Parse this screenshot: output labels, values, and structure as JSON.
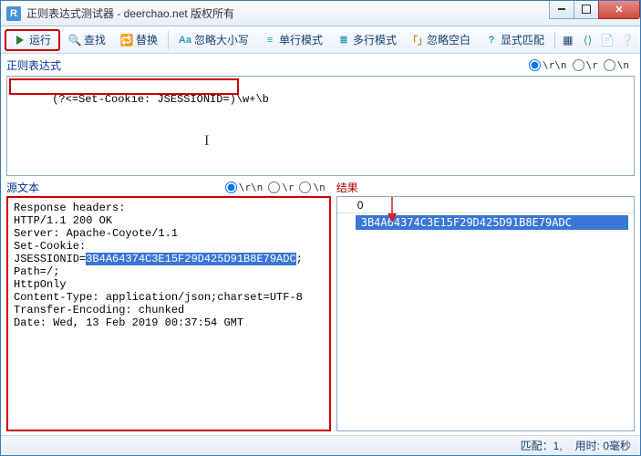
{
  "title": "正则表达式测试器 - deerchao.net 版权所有",
  "toolbar": {
    "run": "运行",
    "find": "查找",
    "replace": "替换",
    "ignorecase": "忽略大小写",
    "singleline": "单行模式",
    "multiline": "多行模式",
    "ignorews": "忽略空白",
    "explicit": "显式匹配"
  },
  "labels": {
    "regex": "正则表达式",
    "source": "源文本",
    "result": "结果"
  },
  "lineend": {
    "crlf": "\\r\\n",
    "cr": "\\r",
    "lf": "\\n"
  },
  "regex_input": "(?<=Set-Cookie: JSESSIONID=)\\w+\\b",
  "source_text": {
    "l1": "Response headers:",
    "l2": "HTTP/1.1 200 OK",
    "l3": "Server: Apache-Coyote/1.1",
    "l4": "Set-Cookie:",
    "l5a": "JSESSIONID=",
    "l5b": "3B4A64374C3E15F29D425D91B8E79ADC",
    "l5c": "; Path=/;",
    "l6": "HttpOnly",
    "l7": "Content-Type: application/json;charset=UTF-8",
    "l8": "Transfer-Encoding: chunked",
    "l9": "Date: Wed, 13 Feb 2019 00:37:54 GMT"
  },
  "result": {
    "header": "0",
    "match": "3B4A64374C3E15F29D425D91B8E79ADC"
  },
  "status": {
    "matches": "匹配：1,",
    "time": "用时: 0毫秒"
  }
}
